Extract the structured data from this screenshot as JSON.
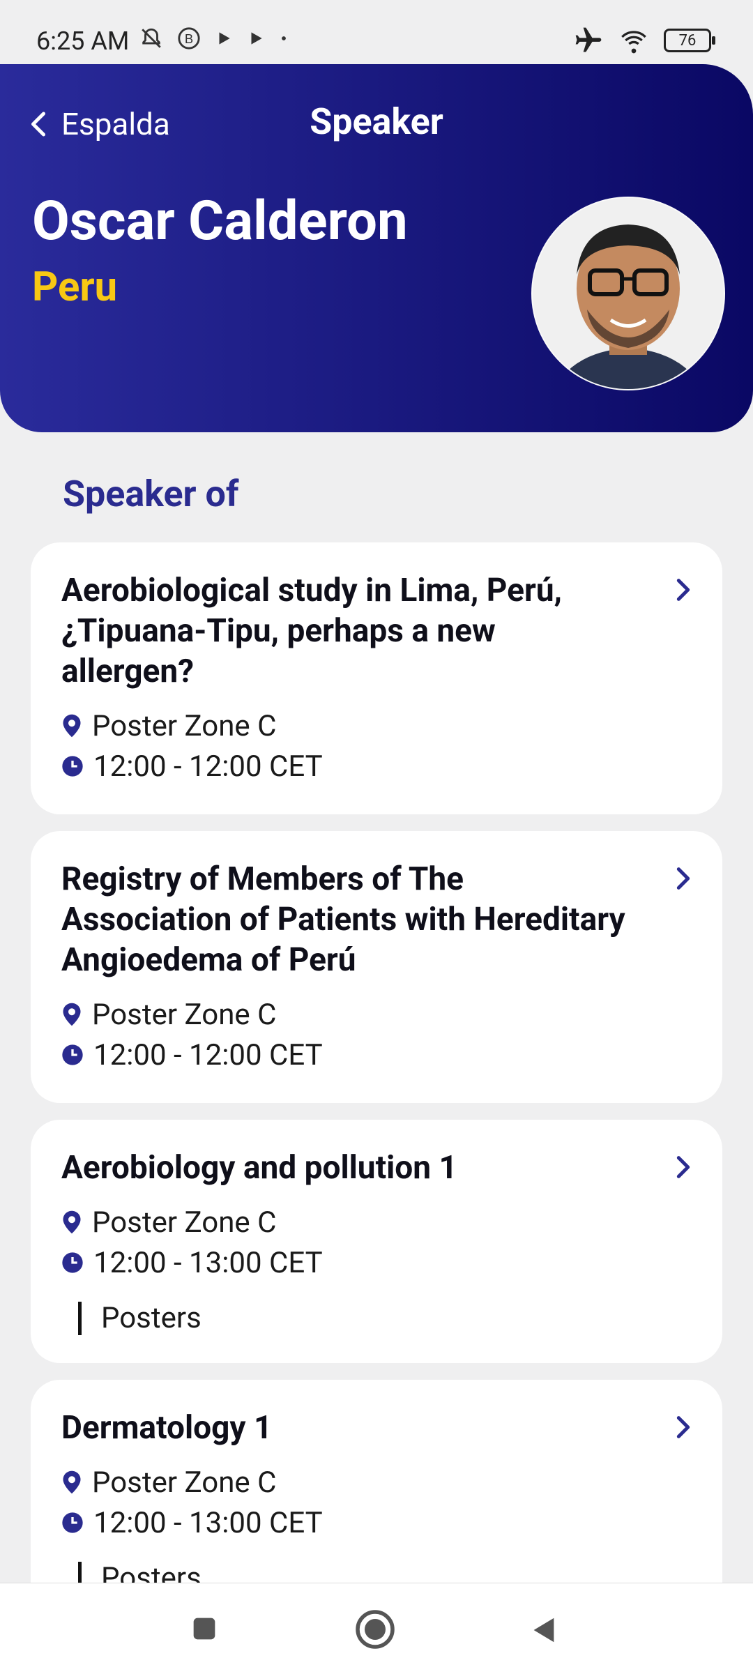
{
  "status_bar": {
    "time": "6:25 AM",
    "battery": "76",
    "icons": [
      "mute-bell-icon",
      "b-badge-icon",
      "play-icon",
      "play-icon",
      "dot-icon",
      "airplane-icon",
      "wifi-icon",
      "battery-icon"
    ]
  },
  "header": {
    "back_label": "Espalda",
    "title": "Speaker"
  },
  "speaker": {
    "name": "Oscar Calderon",
    "country": "Peru"
  },
  "section": {
    "title": "Speaker of"
  },
  "sessions": [
    {
      "title": "Aerobiological study in Lima, Perú, ¿Tipuana-Tipu, perhaps a new allergen?",
      "location": "Poster Zone C",
      "time": "12:00 - 12:00 CET"
    },
    {
      "title": "Registry of Members of The Association of Patients with Hereditary Angioedema of Perú",
      "location": "Poster Zone C",
      "time": "12:00 - 12:00 CET"
    },
    {
      "title": "Aerobiology and pollution 1",
      "location": "Poster Zone C",
      "time": "12:00 - 13:00 CET",
      "tag": "Posters"
    },
    {
      "title": "Dermatology 1",
      "location": "Poster Zone C",
      "time": "12:00 - 13:00 CET",
      "tag": "Posters"
    }
  ],
  "colors": {
    "header_gradient_start": "#2a2b9b",
    "header_gradient_end": "#0a0864",
    "accent_yellow": "#f8c814",
    "section_title": "#2a2b8f",
    "icon_blue": "#2a2b8f"
  }
}
